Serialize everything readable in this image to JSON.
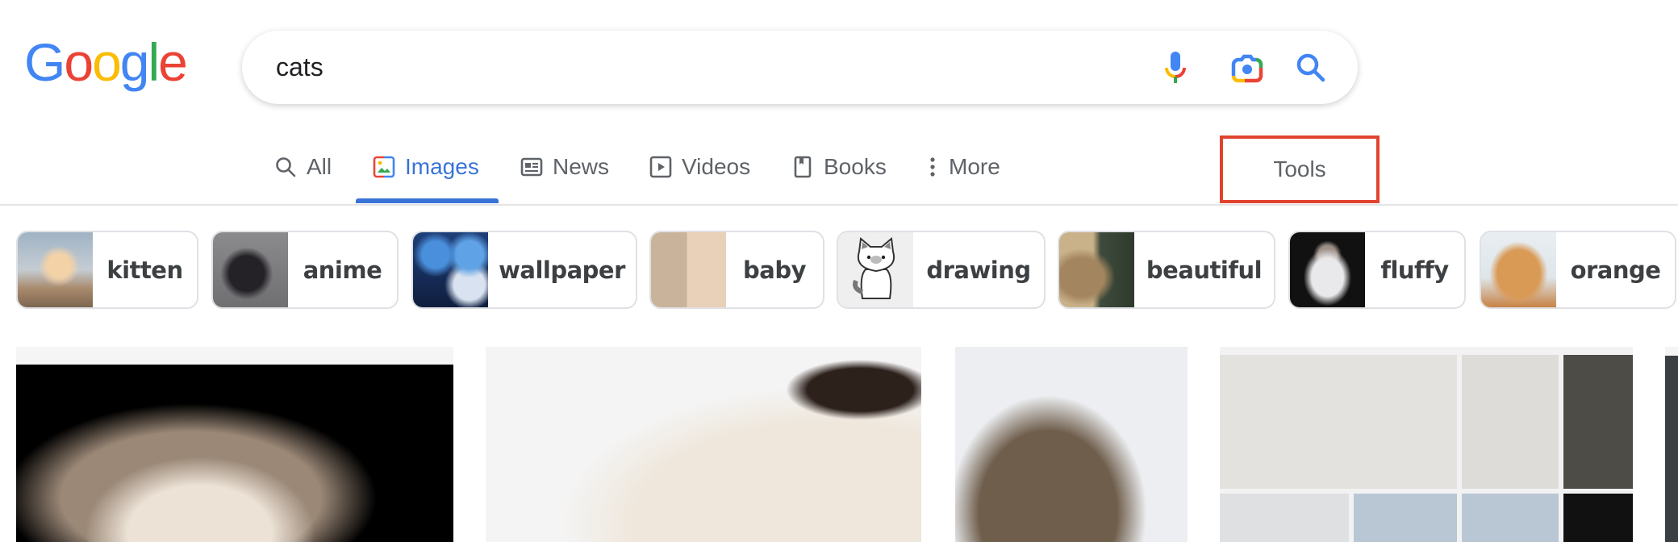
{
  "logo": {
    "letters": [
      {
        "ch": "G",
        "color": "#4285f4"
      },
      {
        "ch": "o",
        "color": "#ea4335"
      },
      {
        "ch": "o",
        "color": "#fbbc05"
      },
      {
        "ch": "g",
        "color": "#4285f4"
      },
      {
        "ch": "l",
        "color": "#34a853"
      },
      {
        "ch": "e",
        "color": "#ea4335"
      }
    ],
    "alt": "Google"
  },
  "search": {
    "query": "cats",
    "voice_label": "Search by voice",
    "lens_label": "Search by image",
    "submit_label": "Search"
  },
  "nav": {
    "tabs": [
      {
        "label": "All",
        "icon": "search-icon",
        "active": false
      },
      {
        "label": "Images",
        "icon": "image-icon",
        "active": true
      },
      {
        "label": "News",
        "icon": "news-icon",
        "active": false
      },
      {
        "label": "Videos",
        "icon": "play-icon",
        "active": false
      },
      {
        "label": "Books",
        "icon": "book-icon",
        "active": false
      },
      {
        "label": "More",
        "icon": "more-vert-icon",
        "active": false
      }
    ],
    "tools_label": "Tools",
    "accent": "#3a73d8",
    "highlight": "#e0432e"
  },
  "chips": [
    {
      "label": "kitten"
    },
    {
      "label": "anime"
    },
    {
      "label": "wallpaper"
    },
    {
      "label": "baby"
    },
    {
      "label": "drawing"
    },
    {
      "label": "beautiful"
    },
    {
      "label": "fluffy"
    },
    {
      "label": "orange"
    }
  ],
  "results": [
    {
      "alt": "cat on black background"
    },
    {
      "alt": "himalayan cat"
    },
    {
      "alt": "tabby cat"
    },
    {
      "alt": "cat collage"
    },
    {
      "alt": "cat"
    }
  ]
}
